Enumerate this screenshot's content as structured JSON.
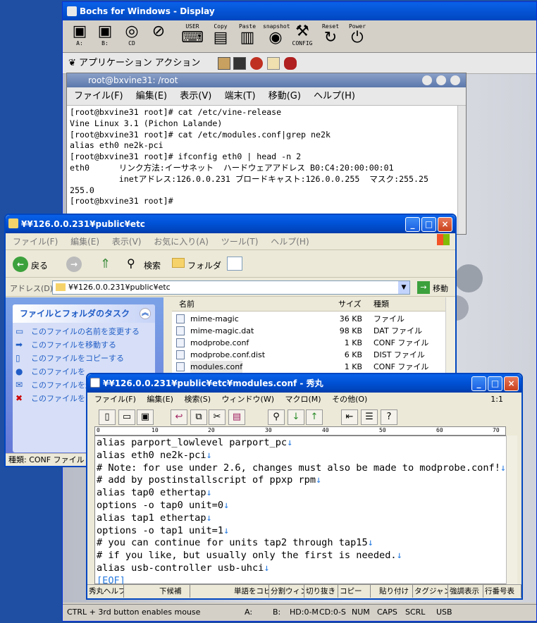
{
  "bochs": {
    "title": "Bochs for Windows - Display",
    "toolbar": [
      {
        "label": "A:",
        "icon": "floppy-icon"
      },
      {
        "label": "B:",
        "icon": "floppy-icon"
      },
      {
        "label": "CD",
        "icon": "cdrom-icon"
      },
      {
        "label": "",
        "icon": "mouse-icon"
      },
      {
        "label": "USER",
        "icon": "keyboard-icon"
      },
      {
        "label": "Copy",
        "icon": "copy-icon"
      },
      {
        "label": "Paste",
        "icon": "paste-icon"
      },
      {
        "label": "snapshot",
        "icon": "camera-icon"
      },
      {
        "label": "CONFIG",
        "icon": "config-icon"
      },
      {
        "label": "Reset",
        "icon": "reset-icon"
      },
      {
        "label": "Power",
        "icon": "power-icon"
      }
    ],
    "panel": "アプリケーション  アクション",
    "status": {
      "hint": "CTRL + 3rd button enables mouse",
      "a": "A:",
      "b": "B:",
      "hd": "HD:0-M",
      "cd": "CD:0-S",
      "num": "NUM",
      "caps": "CAPS",
      "scrl": "SCRL",
      "usb": "USB"
    }
  },
  "terminal": {
    "title": "root@bxvine31: /root",
    "menu": [
      "ファイル(F)",
      "編集(E)",
      "表示(V)",
      "端末(T)",
      "移動(G)",
      "ヘルプ(H)"
    ],
    "lines": [
      "[root@bxvine31 root]# cat /etc/vine-release",
      "Vine Linux 3.1 (Pichon Lalande)",
      "[root@bxvine31 root]# cat /etc/modules.conf|grep ne2k",
      "alias eth0 ne2k-pci",
      "[root@bxvine31 root]# ifconfig eth0 | head -n 2",
      "eth0      リンク方法:イーサネット  ハードウェアアドレス B0:C4:20:00:00:01",
      "          inetアドレス:126.0.0.231 ブロードキャスト:126.0.0.255  マスク:255.25",
      "255.0",
      "[root@bxvine31 root]#"
    ]
  },
  "explorer": {
    "title": "¥¥126.0.0.231¥public¥etc",
    "menu": [
      "ファイル(F)",
      "編集(E)",
      "表示(V)",
      "お気に入り(A)",
      "ツール(T)",
      "ヘルプ(H)"
    ],
    "back": "戻る",
    "search": "検索",
    "folders": "フォルダ",
    "address_label": "アドレス(D)",
    "address": "¥¥126.0.0.231¥public¥etc",
    "go": "移動",
    "task_title": "ファイルとフォルダのタスク",
    "tasks": [
      "このファイルの名前を変更する",
      "このファイルを移動する",
      "このファイルをコピーする",
      "このファイルを",
      "このファイルを送信する",
      "このファイルを"
    ],
    "columns": {
      "name": "名前",
      "size": "サイズ",
      "type": "種類"
    },
    "files": [
      {
        "name": "mime-magic",
        "size": "36 KB",
        "type": "ファイル"
      },
      {
        "name": "mime-magic.dat",
        "size": "98 KB",
        "type": "DAT ファイル"
      },
      {
        "name": "modprobe.conf",
        "size": "1 KB",
        "type": "CONF ファイル"
      },
      {
        "name": "modprobe.conf.dist",
        "size": "6 KB",
        "type": "DIST ファイル"
      },
      {
        "name": "modules.conf",
        "size": "1 KB",
        "type": "CONF ファイル"
      }
    ],
    "status": "種類: CONF ファイル サ"
  },
  "hidemaru": {
    "title": "¥¥126.0.0.231¥public¥etc¥modules.conf - 秀丸",
    "menu": [
      "ファイル(F)",
      "編集(E)",
      "検索(S)",
      "ウィンドウ(W)",
      "マクロ(M)",
      "その他(O)"
    ],
    "position": "1:1",
    "ruler": [
      "0",
      "10",
      "20",
      "30",
      "40",
      "50",
      "60",
      "70"
    ],
    "lines": [
      "alias parport_lowlevel parport_pc",
      "alias eth0 ne2k-pci",
      "# Note: for use under 2.6, changes must also be made to modprobe.conf!",
      "# add by postinstallscript of ppxp rpm",
      "alias tap0 ethertap",
      "options -o tap0 unit=0",
      "alias tap1 ethertap",
      "options -o tap1 unit=1",
      "# you can continue for units tap2 through tap15",
      "# if you like, but usually only the first is needed.",
      "alias usb-controller usb-uhci"
    ],
    "newline_mark": "↓",
    "eof": "[EOF]",
    "fkeys": [
      "秀丸ヘルプ",
      "",
      "下候補",
      "",
      "単語をコピ",
      "分割ウィンド",
      "切り抜き",
      "コピー",
      "",
      "貼り付け",
      "タグジャンプ",
      "強調表示",
      "行番号表"
    ]
  },
  "colors": {
    "xp_blue": "#0046c0",
    "desktop": "#1f4fa3",
    "link": "#215dc6",
    "newline": "#2b7de0"
  }
}
